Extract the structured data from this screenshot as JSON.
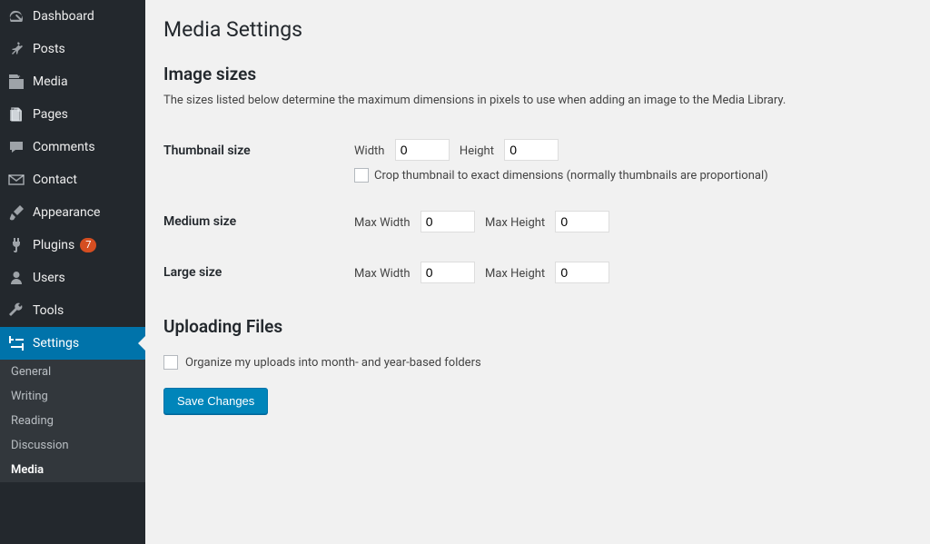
{
  "sidebar": {
    "items": [
      {
        "label": "Dashboard",
        "icon": "dashboard"
      },
      {
        "label": "Posts",
        "icon": "pin"
      },
      {
        "label": "Media",
        "icon": "media"
      },
      {
        "label": "Pages",
        "icon": "pages"
      },
      {
        "label": "Comments",
        "icon": "comments"
      },
      {
        "label": "Contact",
        "icon": "envelope"
      },
      {
        "label": "Appearance",
        "icon": "brush"
      },
      {
        "label": "Plugins",
        "icon": "plug",
        "badge": "7"
      },
      {
        "label": "Users",
        "icon": "user"
      },
      {
        "label": "Tools",
        "icon": "wrench"
      },
      {
        "label": "Settings",
        "icon": "sliders",
        "current": true
      }
    ],
    "submenu": {
      "items": [
        {
          "label": "General"
        },
        {
          "label": "Writing"
        },
        {
          "label": "Reading"
        },
        {
          "label": "Discussion"
        },
        {
          "label": "Media",
          "active": true
        }
      ]
    }
  },
  "page": {
    "title": "Media Settings",
    "section_image_sizes": "Image sizes",
    "image_sizes_desc": "The sizes listed below determine the maximum dimensions in pixels to use when adding an image to the Media Library.",
    "thumbnail": {
      "row_label": "Thumbnail size",
      "width_label": "Width",
      "width_value": "0",
      "height_label": "Height",
      "height_value": "0",
      "crop_label": "Crop thumbnail to exact dimensions (normally thumbnails are proportional)",
      "crop_checked": false
    },
    "medium": {
      "row_label": "Medium size",
      "maxwidth_label": "Max Width",
      "maxwidth_value": "0",
      "maxheight_label": "Max Height",
      "maxheight_value": "0"
    },
    "large": {
      "row_label": "Large size",
      "maxwidth_label": "Max Width",
      "maxwidth_value": "0",
      "maxheight_label": "Max Height",
      "maxheight_value": "0"
    },
    "section_uploading": "Uploading Files",
    "organize_label": "Organize my uploads into month- and year-based folders",
    "organize_checked": false,
    "save_button": "Save Changes"
  }
}
